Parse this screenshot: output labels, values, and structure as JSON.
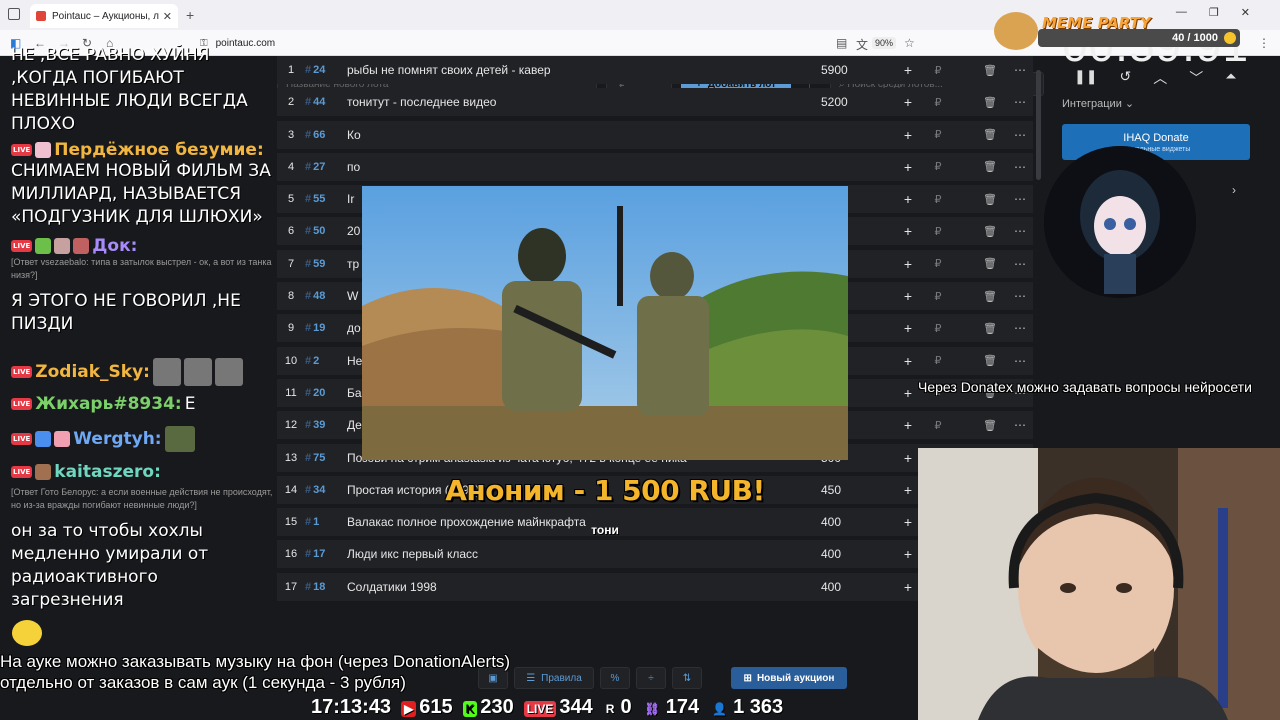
{
  "browser": {
    "tab_title": "Pointauc – Аукционы, лотереи",
    "url": "pointauc.com",
    "zoom": "90%"
  },
  "controls": {
    "lot_name_placeholder": "Название нового лота",
    "price_placeholder": "₽",
    "add_lot_label": "Добавить лот",
    "search_placeholder": "Поиск среди лотов..."
  },
  "lots": [
    {
      "n": "1",
      "id": "24",
      "name": "рыбы не помнят своих детей - кавер",
      "amount": "5900"
    },
    {
      "n": "2",
      "id": "44",
      "name": "тонитут - последнее видео",
      "amount": "5200"
    },
    {
      "n": "3",
      "id": "66",
      "name": "Ко",
      "amount": ""
    },
    {
      "n": "4",
      "id": "27",
      "name": "по",
      "amount": ""
    },
    {
      "n": "5",
      "id": "55",
      "name": "Ir",
      "amount": ""
    },
    {
      "n": "6",
      "id": "50",
      "name": "20",
      "amount": ""
    },
    {
      "n": "7",
      "id": "59",
      "name": "тр",
      "amount": ""
    },
    {
      "n": "8",
      "id": "48",
      "name": "W",
      "amount": ""
    },
    {
      "n": "9",
      "id": "19",
      "name": "до",
      "amount": ""
    },
    {
      "n": "10",
      "id": "2",
      "name": "Не",
      "amount": ""
    },
    {
      "n": "11",
      "id": "20",
      "name": "Ба",
      "amount": ""
    },
    {
      "n": "12",
      "id": "39",
      "name": "Депутат Жмильст онг попадает в Верховно Ра д...ма и выступ",
      "amount": "500"
    },
    {
      "n": "13",
      "id": "75",
      "name": "Позови на стрим anastasia из чата ютуб, 472 в конце ее ника",
      "amount": "500"
    },
    {
      "n": "14",
      "id": "34",
      "name": "Простая история (1999)",
      "amount": "450"
    },
    {
      "n": "15",
      "id": "1",
      "name": "Валакас полное прохождение майнкрафта",
      "amount": "400"
    },
    {
      "n": "16",
      "id": "17",
      "name": "Люди икс первый класс",
      "amount": "400"
    },
    {
      "n": "17",
      "id": "18",
      "name": "Солдатики 1998",
      "amount": "400"
    }
  ],
  "alert": {
    "text": "Аноним - 1 500 RUB!",
    "sub": "тони"
  },
  "bottom": {
    "rules_label": "Правила",
    "new_auction_label": "Новый аукцион"
  },
  "chat": {
    "top_lines": "НЕ ,ВСЕ РАВНО ХУЙНЯ ,КОГДА ПОГИБАЮТ НЕВИННЫЕ ЛЮДИ ВСЕГДА ПЛОХО",
    "user1": "Пердёжное безумие:",
    "msg1": "СНИМАЕМ НОВЫЙ ФИЛЬМ ЗА МИЛЛИАРД, НАЗЫВАЕТСЯ «ПОДГУЗНИК ДЛЯ ШЛЮХИ»",
    "user2": "Док:",
    "reply2": "[Ответ vsezaebalo: типа в затылок выстрел - ок, а вот из танка низя?]",
    "msg2": "Я ЭТОГО НЕ ГОВОРИЛ ,НЕ ПИЗДИ",
    "user3": "Zodiak_Sky:",
    "user4": "Жихарь#8934:",
    "msg4": "Е",
    "user5": "Wergtyh:",
    "user6": "kaitaszero:",
    "reply6": "[Ответ Гото Белорус: а если военные действия не происходят, но из-за вражды погибают невинные люди?]",
    "msg6": "он за то чтобы хохлы медленно умирали от радиоактивного загрезнения"
  },
  "timer": {
    "value": "00:59:91",
    "integrations_label": "Интеграции"
  },
  "ihaq": {
    "title": "IHAQ Donate",
    "sub": "визуальные виджеты"
  },
  "meme": {
    "title": "MEME PARTY",
    "progress_text": "40 / 1000",
    "progress_fraction": 0.04
  },
  "overlay": {
    "ticker": "Через Donatex можно задавать вопросы нейросети",
    "music_line1": "На ауке можно заказывать музыку на фон (через DonationAlerts)",
    "music_line2": "отдельно от заказов в сам аук (1 секунда - 3 рубля)"
  },
  "stats": {
    "time": "17:13:43",
    "youtube": "615",
    "kick": "230",
    "live": "344",
    "rumble": "0",
    "twitch": "174",
    "viewers": "1 363"
  }
}
